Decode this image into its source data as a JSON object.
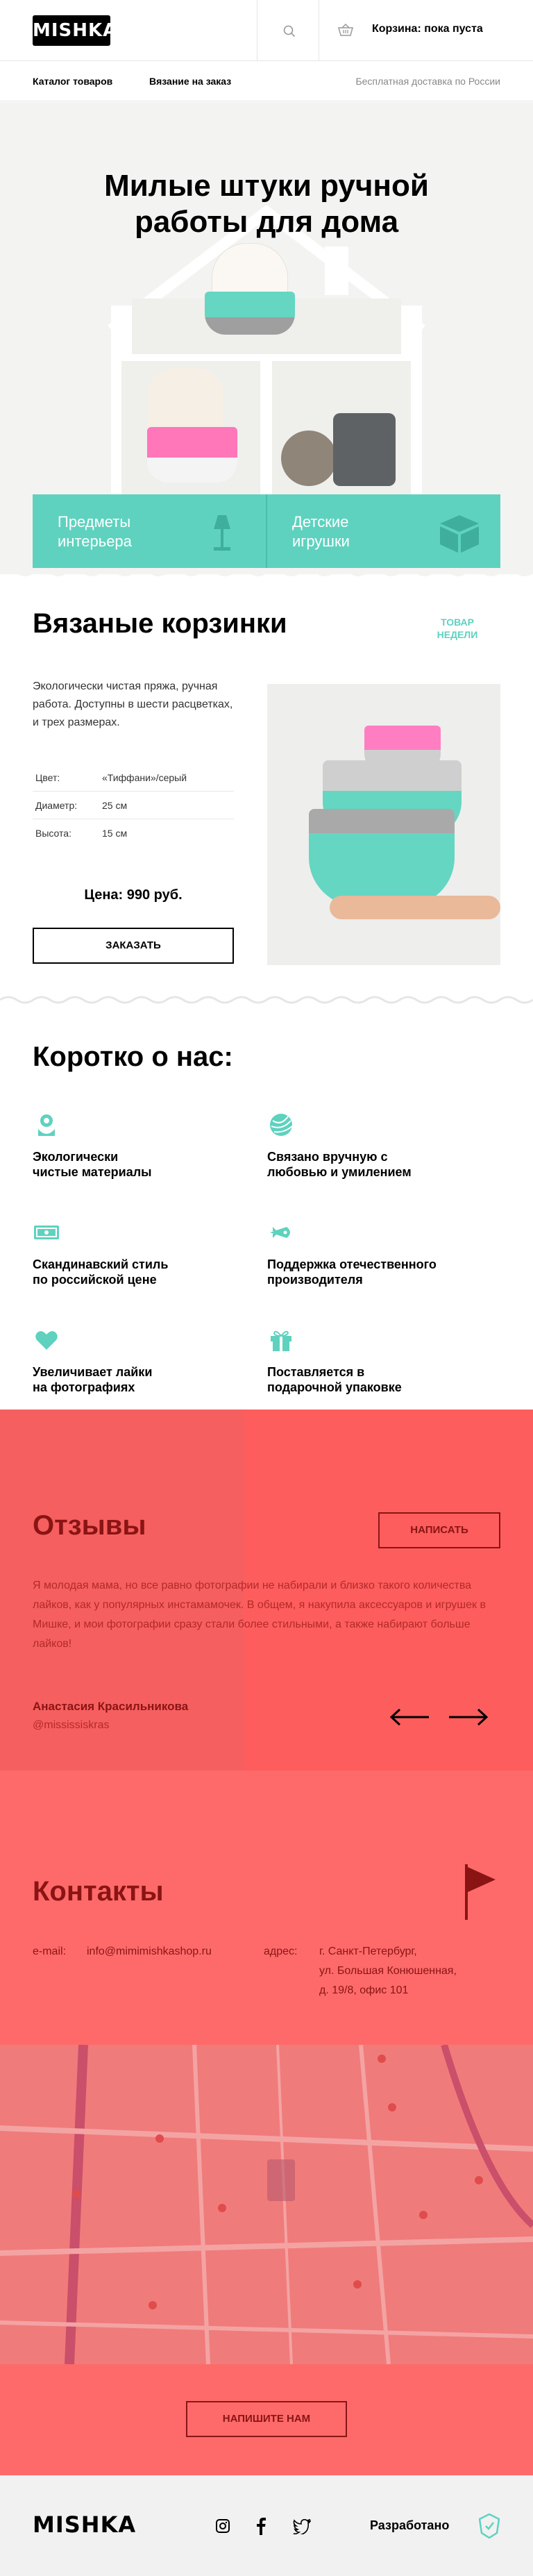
{
  "header": {
    "logo": "MISHKA",
    "cart_label": "Корзина: пока пуста"
  },
  "nav": {
    "items": [
      {
        "label": "Каталог товаров"
      },
      {
        "label": "Вязание на заказ"
      }
    ],
    "free_shipping": "Бесплатная доставка по России"
  },
  "hero": {
    "title_line1": "Милые штуки ручной",
    "title_line2": "работы для дома",
    "tiles": [
      {
        "line1": "Предметы",
        "line2": "интерьера",
        "icon": "lamp-icon"
      },
      {
        "line1": "Детские",
        "line2": "игрушки",
        "icon": "toy-cube-icon"
      }
    ]
  },
  "product": {
    "title": "Вязаные корзинки",
    "week_tag_line1": "ТОВАР",
    "week_tag_line2": "НЕДЕЛИ",
    "description": "Экологически чистая пряжа, ручная работа. Доступны в шести расцветках, и трех размерах.",
    "specs": [
      {
        "key": "Цвет:",
        "value": "«Тиффани»/серый"
      },
      {
        "key": "Диаметр:",
        "value": "25 см"
      },
      {
        "key": "Высота:",
        "value": "15 см"
      }
    ],
    "price": "Цена: 990 руб.",
    "order_button": "ЗАКАЗАТЬ"
  },
  "about": {
    "title": "Коротко о нас:",
    "features": [
      {
        "line1": "Экологически",
        "line2": "чистые материалы",
        "icon": "flower-icon"
      },
      {
        "line1": "Связано вручную с",
        "line2": "любовью и умилением",
        "icon": "yarn-ball-icon"
      },
      {
        "line1": "Скандинавский стиль",
        "line2": "по российской цене",
        "icon": "banknote-icon"
      },
      {
        "line1": "Поддержка отечественного",
        "line2": "производителя",
        "icon": "rocket-icon"
      },
      {
        "line1": "Увеличивает лайки",
        "line2": "на фотографиях",
        "icon": "heart-icon"
      },
      {
        "line1": "Поставляется в",
        "line2": "подарочной упаковке",
        "icon": "gift-icon"
      }
    ]
  },
  "reviews": {
    "title": "Отзывы",
    "write_button": "НАПИСАТЬ",
    "text": "Я молодая мама, но все равно фотографии не набирали и близко такого количества лайков, как у популярных инстамамочек. В общем, я накупила аксессуаров и игрушек в Мишке, и мои фотографии сразу стали более стильными, а также набирают больше лайков!",
    "author": "Анастасия Красильникова",
    "handle": "@mississiskras"
  },
  "contacts": {
    "title": "Контакты",
    "email_label": "e-mail:",
    "email_value": "info@mimimishkashop.ru",
    "address_label": "адрес:",
    "address_line1": "г. Санкт-Петербург,",
    "address_line2": "ул. Большая Конюшенная,",
    "address_line3": "д. 19/8, офис 101",
    "write_us_button": "НАПИШИТЕ НАМ"
  },
  "footer": {
    "logo": "MISHKA",
    "developed": "Разработано"
  },
  "colors": {
    "accent": "#5ed2bf",
    "reviews_bg": "#fe5d5d",
    "dark_red": "#8a1414"
  }
}
